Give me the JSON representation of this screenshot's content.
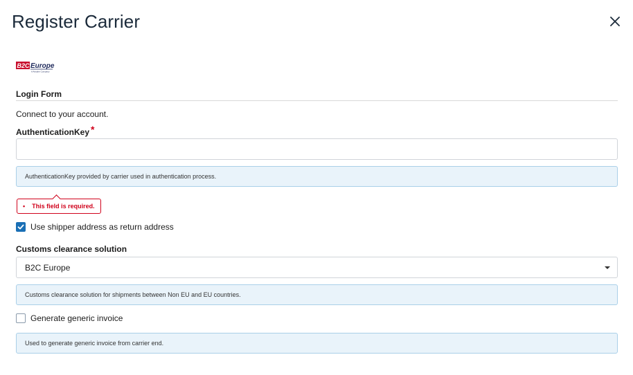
{
  "dialog": {
    "title": "Register Carrier",
    "close_icon": "close-icon"
  },
  "logo": {
    "text_main": "B2C",
    "text_secondary": "Europe",
    "tagline": "A Ariadne Company",
    "colors": {
      "red": "#c8102e",
      "navy": "#1f2a5c"
    }
  },
  "form": {
    "section_title": "Login Form",
    "intro": "Connect to your account.",
    "auth_key": {
      "label": "AuthenticationKey",
      "required_marker": "*",
      "value": "",
      "placeholder": "",
      "help": "AuthenticationKey provided by carrier used in authentication process.",
      "error_bullet": "•",
      "error": "This field is required."
    },
    "use_shipper_address": {
      "label": "Use shipper address as return address",
      "checked": true
    },
    "customs": {
      "label": "Customs clearance solution",
      "selected": "B2C Europe",
      "help": "Customs clearance solution for shipments between Non EU and EU countries."
    },
    "generic_invoice": {
      "label": "Generate generic invoice",
      "checked": false,
      "help": "Used to generate generic invoice from carrier end."
    }
  },
  "colors": {
    "accent": "#1a6fb5",
    "error": "#d0021b",
    "info_bg": "#e9f3fa",
    "info_border": "#a9cfe8"
  }
}
